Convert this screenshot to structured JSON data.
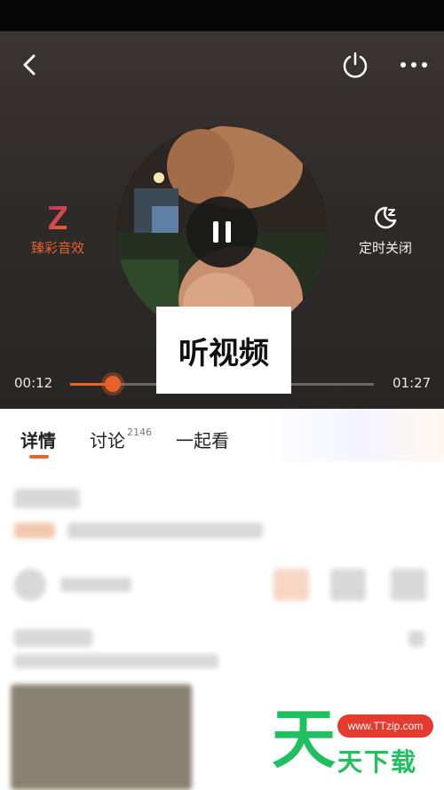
{
  "player": {
    "audio_fx_label": "臻彩音效",
    "timer_label": "定时关闭",
    "current_time": "00:12",
    "total_time": "01:27",
    "progress": 0.14,
    "mode_badge": "听视频"
  },
  "tabs": [
    {
      "label": "详情",
      "active": true
    },
    {
      "label": "讨论",
      "count": "2146"
    },
    {
      "label": "一起看"
    }
  ],
  "watermark": {
    "big_char": "天",
    "url": "www.TTzip.com",
    "sub_text": "天下载"
  },
  "colors": {
    "accent": "#e8622c",
    "watermark_green": "#20c060",
    "watermark_red": "#e53a2e"
  }
}
